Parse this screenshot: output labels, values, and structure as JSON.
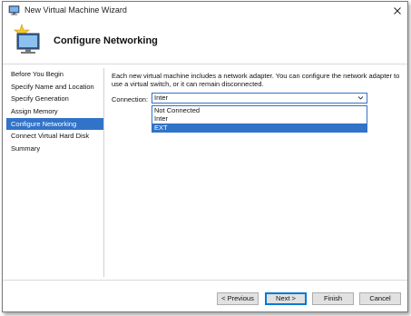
{
  "window": {
    "title": "New Virtual Machine Wizard"
  },
  "header": {
    "page_title": "Configure Networking"
  },
  "sidebar": {
    "items": [
      {
        "label": "Before You Begin"
      },
      {
        "label": "Specify Name and Location"
      },
      {
        "label": "Specify Generation"
      },
      {
        "label": "Assign Memory"
      },
      {
        "label": "Configure Networking"
      },
      {
        "label": "Connect Virtual Hard Disk"
      },
      {
        "label": "Summary"
      }
    ],
    "active_index": 4
  },
  "content": {
    "description": "Each new virtual machine includes a network adapter. You can configure the network adapter to use a virtual switch, or it can remain disconnected.",
    "connection_label": "Connection:",
    "connection_value": "Inter",
    "options": [
      "Not Connected",
      "Inter",
      "EXT"
    ],
    "highlighted_option": "EXT"
  },
  "footer": {
    "previous_label": "< Previous",
    "next_label": "Next >",
    "finish_label": "Finish",
    "cancel_label": "Cancel"
  },
  "colors": {
    "accent": "#3173c8",
    "button_face": "#e1e1e1",
    "default_border": "#0078d7"
  },
  "icons": {
    "app": "virtual-machine-icon",
    "header": "virtual-machine-star-icon",
    "close": "close-icon",
    "dropdown": "chevron-down-icon"
  }
}
